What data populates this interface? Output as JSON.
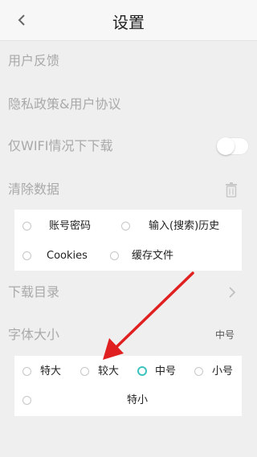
{
  "header": {
    "title": "设置"
  },
  "settings": {
    "feedback": "用户反馈",
    "privacy": "隐私政策&用户协议",
    "wifi_only": "仅WIFI情况下下载",
    "clear_data": "清除数据",
    "download_dir": "下载目录",
    "font_size": "字体大小",
    "font_size_value": "中号"
  },
  "clear_options": [
    "账号密码",
    "输入(搜索)历史",
    "Cookies",
    "缓存文件"
  ],
  "font_options": [
    "特大",
    "较大",
    "中号",
    "小号",
    "特小"
  ],
  "colors": {
    "accent": "#3cc3bd",
    "arrow": "#e02020"
  },
  "state": {
    "wifi_only_enabled": false,
    "selected_font": "中号"
  }
}
